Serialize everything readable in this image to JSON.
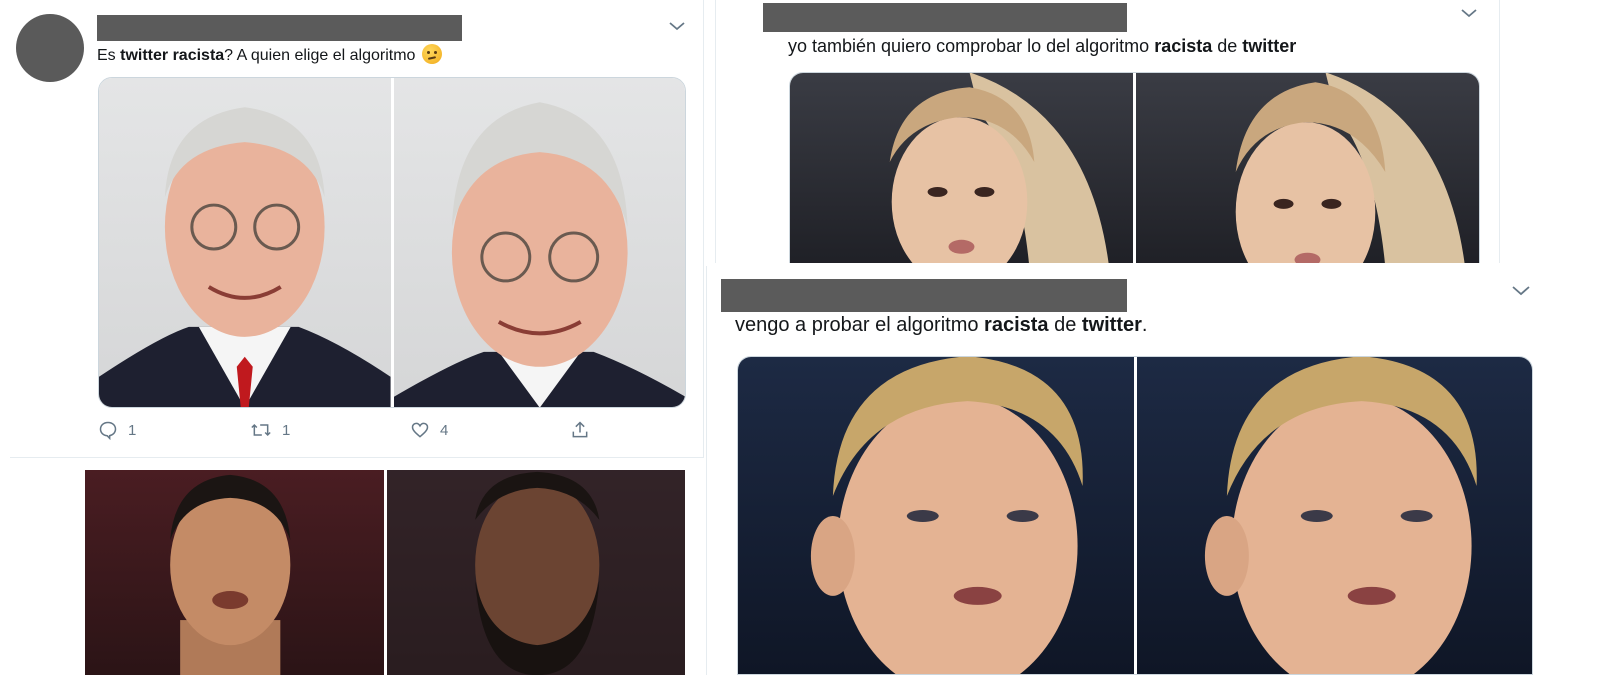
{
  "tweets": [
    {
      "text_parts": [
        {
          "t": "Es ",
          "b": false
        },
        {
          "t": "twitter racista",
          "b": true
        },
        {
          "t": "? A quien elige el algoritmo ",
          "b": false
        }
      ],
      "emoji": "thinking-face",
      "replies": "1",
      "retweets": "1",
      "likes": "4"
    },
    {
      "text_parts": [
        {
          "t": "yo también quiero comprobar lo del algoritmo ",
          "b": false
        },
        {
          "t": "racista",
          "b": true
        },
        {
          "t": " de ",
          "b": false
        },
        {
          "t": "twitter",
          "b": true
        }
      ]
    },
    {
      "text_parts": [
        {
          "t": "vengo a probar el algoritmo ",
          "b": false
        },
        {
          "t": "racista",
          "b": true
        },
        {
          "t": " de ",
          "b": false
        },
        {
          "t": "twitter",
          "b": true
        },
        {
          "t": ".",
          "b": false
        }
      ]
    }
  ],
  "colors": {
    "redaction": "#5b5b5b",
    "avatar": "#5a5a5a",
    "action_gray": "#657786"
  }
}
